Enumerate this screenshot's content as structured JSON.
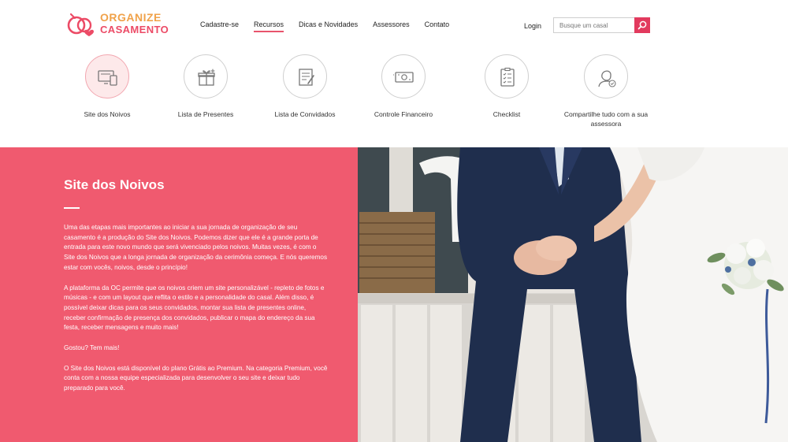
{
  "logo": {
    "line1": "ORGANIZE",
    "line2": "CASAMENTO",
    "colors": {
      "orange": "#f0a24a",
      "pink": "#ec4b66"
    }
  },
  "nav": {
    "items": [
      {
        "label": "Cadastre-se",
        "active": false
      },
      {
        "label": "Recursos",
        "active": true
      },
      {
        "label": "Dicas e Novidades",
        "active": false
      },
      {
        "label": "Assessores",
        "active": false
      },
      {
        "label": "Contato",
        "active": false
      }
    ],
    "login": "Login"
  },
  "search": {
    "placeholder": "Busque um casal",
    "icon": "search-icon"
  },
  "features": [
    {
      "label": "Site dos Noivos",
      "icon": "website-devices-icon",
      "active": true
    },
    {
      "label": "Lista de Presentes",
      "icon": "gift-icon",
      "active": false
    },
    {
      "label": "Lista de Convidados",
      "icon": "guest-list-icon",
      "active": false
    },
    {
      "label": "Controle Financeiro",
      "icon": "money-icon",
      "active": false
    },
    {
      "label": "Checklist",
      "icon": "checklist-icon",
      "active": false
    },
    {
      "label": "Compartilhe tudo com a sua assessora",
      "icon": "advisor-icon",
      "active": false
    }
  ],
  "section": {
    "title": "Site dos Noivos",
    "paragraphs": [
      "Uma das etapas mais importantes ao iniciar a sua jornada de organização de seu casamento é a produção do Site dos Noivos. Podemos dizer que ele é a grande porta de entrada para este novo mundo que será vivenciado pelos noivos. Muitas vezes, é com o Site dos Noivos que a longa jornada de organização da cerimônia começa. E nós queremos estar com vocês, noivos, desde o princípio!",
      "A plataforma da OC permite que os noivos criem um site personalizável - repleto de fotos e músicas - e com um layout que reflita o estilo e a personalidade do casal. Além disso, é possível deixar dicas para os seus convidados, montar sua lista de presentes online, receber confirmação de presença dos convidados, publicar o mapa do endereço da sua festa, receber mensagens e muito mais!",
      "Gostou? Tem mais!",
      "O Site dos Noivos está disponível do plano Grátis ao Premium. Na categoria Premium, você conta com a nossa equipe especializada para desenvolver o seu site e deixar tudo preparado para você."
    ],
    "background_color": "#f05a6f"
  },
  "accent_color": "#e23a5e"
}
